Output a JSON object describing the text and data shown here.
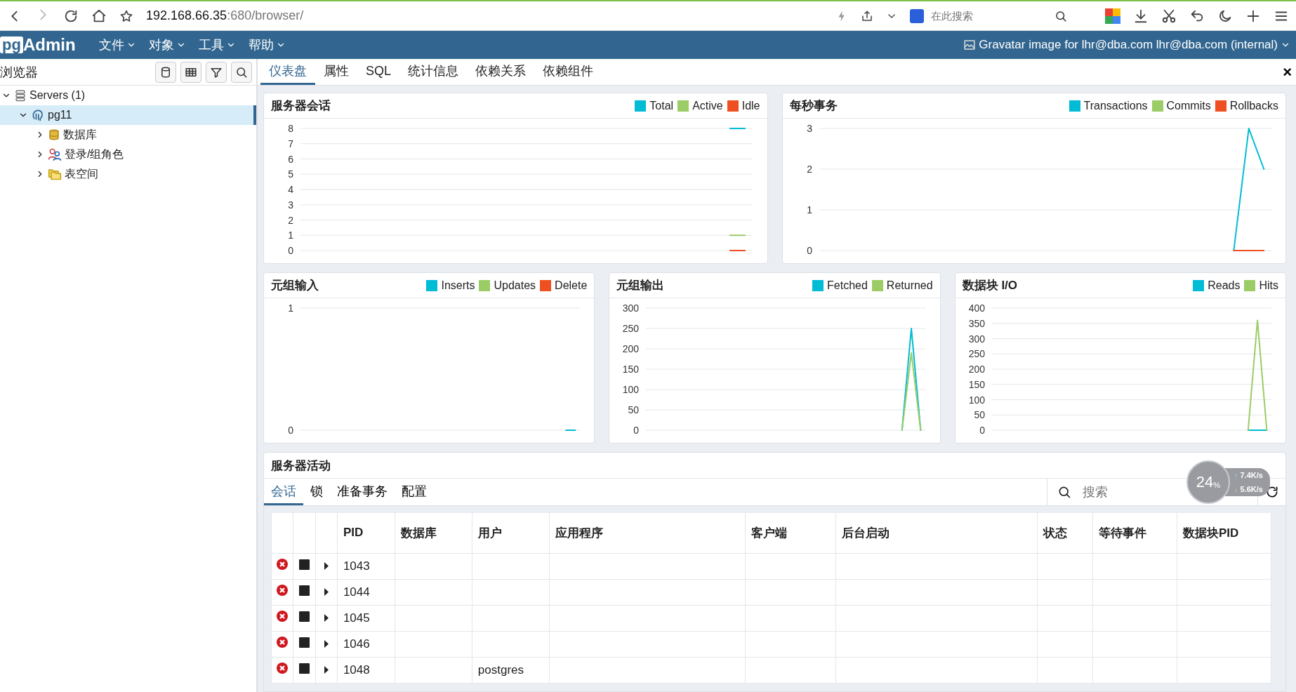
{
  "browser": {
    "url_host": "192.168.66.35",
    "url_path": ":680/browser/",
    "search_placeholder": "在此搜索"
  },
  "app": {
    "logo_pg": "pg",
    "logo_rest": "Admin",
    "menus": [
      {
        "label": "文件"
      },
      {
        "label": "对象"
      },
      {
        "label": "工具"
      },
      {
        "label": "帮助"
      }
    ],
    "user_image_alt": "Gravatar image for lhr@dba.com",
    "user": "lhr@dba.com (internal)"
  },
  "sidebar": {
    "title": "浏览器",
    "tree": [
      {
        "label": "Servers (1)",
        "kind": "servers",
        "expanded": true,
        "selected": false,
        "children": [
          {
            "label": "pg11",
            "kind": "server",
            "expanded": true,
            "selected": true,
            "children": [
              {
                "label": "数据库",
                "kind": "databases",
                "expanded": false,
                "selected": false
              },
              {
                "label": "登录/组角色",
                "kind": "roles",
                "expanded": false,
                "selected": false
              },
              {
                "label": "表空间",
                "kind": "tablespaces",
                "expanded": false,
                "selected": false
              }
            ]
          }
        ]
      }
    ]
  },
  "tabs": [
    {
      "label": "仪表盘",
      "selected": true
    },
    {
      "label": "属性",
      "selected": false
    },
    {
      "label": "SQL",
      "selected": false
    },
    {
      "label": "统计信息",
      "selected": false
    },
    {
      "label": "依赖关系",
      "selected": false
    },
    {
      "label": "依赖组件",
      "selected": false
    }
  ],
  "close_symbol": "×",
  "dashboard": {
    "charts": [
      {
        "title": "服务器会话",
        "chart_data": {
          "type": "line",
          "grid": true,
          "ylim": [
            0,
            8
          ],
          "yticks": [
            0,
            1,
            2,
            3,
            4,
            5,
            6,
            7,
            8
          ],
          "series": [
            {
              "name": "Total",
              "color": "#00bcd4",
              "values": [
                null,
                null,
                null,
                null,
                null,
                null,
                null,
                null,
                null,
                null,
                null,
                null,
                null,
                null,
                null,
                null,
                null,
                null,
                null,
                null,
                null,
                null,
                null,
                null,
                null,
                null,
                null,
                null,
                8,
                8
              ]
            },
            {
              "name": "Active",
              "color": "#9ccc65",
              "values": [
                null,
                null,
                null,
                null,
                null,
                null,
                null,
                null,
                null,
                null,
                null,
                null,
                null,
                null,
                null,
                null,
                null,
                null,
                null,
                null,
                null,
                null,
                null,
                null,
                null,
                null,
                null,
                null,
                1,
                1
              ]
            },
            {
              "name": "Idle",
              "color": "#ef5022",
              "values": [
                null,
                null,
                null,
                null,
                null,
                null,
                null,
                null,
                null,
                null,
                null,
                null,
                null,
                null,
                null,
                null,
                null,
                null,
                null,
                null,
                null,
                null,
                null,
                null,
                null,
                null,
                null,
                null,
                0,
                0
              ]
            }
          ]
        }
      },
      {
        "title": "每秒事务",
        "chart_data": {
          "type": "line",
          "grid": true,
          "ylim": [
            0,
            3
          ],
          "yticks": [
            0,
            1,
            2,
            3
          ],
          "series": [
            {
              "name": "Transactions",
              "color": "#00bcd4",
              "values": [
                null,
                null,
                null,
                null,
                null,
                null,
                null,
                null,
                null,
                null,
                null,
                null,
                null,
                null,
                null,
                null,
                null,
                null,
                null,
                null,
                null,
                null,
                null,
                null,
                null,
                null,
                null,
                0,
                3,
                2
              ]
            },
            {
              "name": "Commits",
              "color": "#9ccc65",
              "values": [
                null,
                null,
                null,
                null,
                null,
                null,
                null,
                null,
                null,
                null,
                null,
                null,
                null,
                null,
                null,
                null,
                null,
                null,
                null,
                null,
                null,
                null,
                null,
                null,
                null,
                null,
                null,
                null,
                null,
                null
              ]
            },
            {
              "name": "Rollbacks",
              "color": "#ef5022",
              "values": [
                null,
                null,
                null,
                null,
                null,
                null,
                null,
                null,
                null,
                null,
                null,
                null,
                null,
                null,
                null,
                null,
                null,
                null,
                null,
                null,
                null,
                null,
                null,
                null,
                null,
                null,
                null,
                0,
                0,
                0
              ]
            }
          ]
        }
      },
      {
        "title": "元组输入",
        "chart_data": {
          "type": "line",
          "grid": true,
          "ylim": [
            0,
            1
          ],
          "yticks": [
            0,
            1
          ],
          "series": [
            {
              "name": "Inserts",
              "color": "#00bcd4",
              "values": [
                null,
                null,
                null,
                null,
                null,
                null,
                null,
                null,
                null,
                null,
                null,
                null,
                null,
                null,
                null,
                null,
                null,
                null,
                null,
                null,
                null,
                null,
                null,
                null,
                null,
                null,
                null,
                null,
                0,
                0
              ]
            },
            {
              "name": "Updates",
              "color": "#9ccc65",
              "values": [
                null,
                null,
                null,
                null,
                null,
                null,
                null,
                null,
                null,
                null,
                null,
                null,
                null,
                null,
                null,
                null,
                null,
                null,
                null,
                null,
                null,
                null,
                null,
                null,
                null,
                null,
                null,
                null,
                null,
                null
              ]
            },
            {
              "name": "Delete",
              "color": "#ef5022",
              "values": [
                null,
                null,
                null,
                null,
                null,
                null,
                null,
                null,
                null,
                null,
                null,
                null,
                null,
                null,
                null,
                null,
                null,
                null,
                null,
                null,
                null,
                null,
                null,
                null,
                null,
                null,
                null,
                null,
                null,
                null
              ]
            }
          ]
        }
      },
      {
        "title": "元组输出",
        "chart_data": {
          "type": "line",
          "grid": true,
          "ylim": [
            0,
            300
          ],
          "yticks": [
            0,
            50,
            100,
            150,
            200,
            250,
            300
          ],
          "series": [
            {
              "name": "Fetched",
              "color": "#00bcd4",
              "values": [
                null,
                null,
                null,
                null,
                null,
                null,
                null,
                null,
                null,
                null,
                null,
                null,
                null,
                null,
                null,
                null,
                null,
                null,
                null,
                null,
                null,
                null,
                null,
                null,
                null,
                null,
                null,
                0,
                250,
                0
              ]
            },
            {
              "name": "Returned",
              "color": "#9ccc65",
              "values": [
                null,
                null,
                null,
                null,
                null,
                null,
                null,
                null,
                null,
                null,
                null,
                null,
                null,
                null,
                null,
                null,
                null,
                null,
                null,
                null,
                null,
                null,
                null,
                null,
                null,
                null,
                null,
                0,
                190,
                0
              ]
            }
          ]
        }
      },
      {
        "title": "数据块 I/O",
        "chart_data": {
          "type": "line",
          "grid": true,
          "ylim": [
            0,
            400
          ],
          "yticks": [
            0,
            50,
            100,
            150,
            200,
            250,
            300,
            350,
            400
          ],
          "series": [
            {
              "name": "Reads",
              "color": "#00bcd4",
              "values": [
                null,
                null,
                null,
                null,
                null,
                null,
                null,
                null,
                null,
                null,
                null,
                null,
                null,
                null,
                null,
                null,
                null,
                null,
                null,
                null,
                null,
                null,
                null,
                null,
                null,
                null,
                null,
                0,
                0,
                0
              ]
            },
            {
              "name": "Hits",
              "color": "#9ccc65",
              "values": [
                null,
                null,
                null,
                null,
                null,
                null,
                null,
                null,
                null,
                null,
                null,
                null,
                null,
                null,
                null,
                null,
                null,
                null,
                null,
                null,
                null,
                null,
                null,
                null,
                null,
                null,
                null,
                0,
                360,
                0
              ]
            }
          ]
        }
      }
    ],
    "activity": {
      "title": "服务器活动",
      "tabs": [
        {
          "label": "会话",
          "selected": true
        },
        {
          "label": "锁",
          "selected": false
        },
        {
          "label": "准备事务",
          "selected": false
        },
        {
          "label": "配置",
          "selected": false
        }
      ],
      "search_placeholder": "搜索",
      "columns": [
        "PID",
        "数据库",
        "用户",
        "应用程序",
        "客户端",
        "后台启动",
        "状态",
        "等待事件",
        "数据块PID"
      ],
      "rows": [
        {
          "pid": "1043",
          "database": "",
          "user": ""
        },
        {
          "pid": "1044",
          "database": "",
          "user": ""
        },
        {
          "pid": "1045",
          "database": "",
          "user": ""
        },
        {
          "pid": "1046",
          "database": "",
          "user": ""
        },
        {
          "pid": "1048",
          "database": "",
          "user": "postgres"
        }
      ]
    }
  },
  "overlay": {
    "percent": "24",
    "percent_sign": "%",
    "up_symbol": "↑",
    "up": "7.4K/s",
    "down_symbol": "↓",
    "down": "5.6K/s"
  }
}
